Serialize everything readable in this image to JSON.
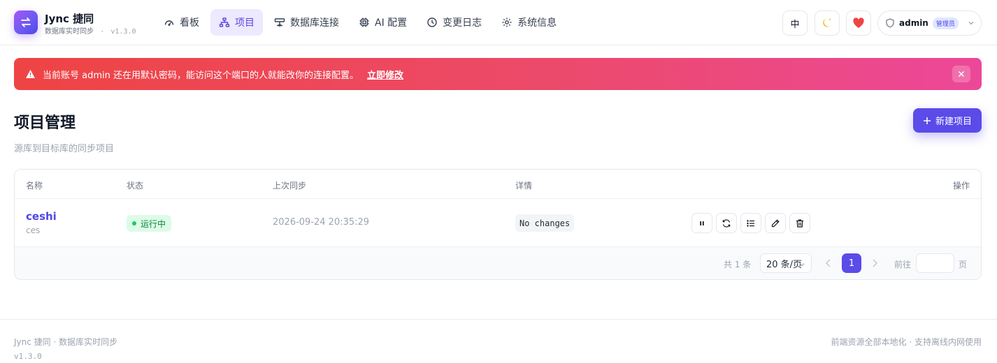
{
  "brand": {
    "name": "Jync 捷同",
    "subtitle": "数据库实时同步",
    "version": "v1.3.0"
  },
  "nav": [
    {
      "label": "看板",
      "icon": "dashboard-icon",
      "active": false
    },
    {
      "label": "项目",
      "icon": "project-tree-icon",
      "active": true
    },
    {
      "label": "数据库连接",
      "icon": "database-connection-icon",
      "active": false
    },
    {
      "label": "AI 配置",
      "icon": "chip-icon",
      "active": false
    },
    {
      "label": "变更日志",
      "icon": "clock-icon",
      "active": false
    },
    {
      "label": "系统信息",
      "icon": "gear-icon",
      "active": false
    }
  ],
  "header": {
    "lang_label": "中",
    "user_name": "admin",
    "user_role": "管理员"
  },
  "banner": {
    "message": "当前账号 admin 还在用默认密码，能访问这个端口的人就能改你的连接配置。",
    "link_label": "立即修改"
  },
  "page": {
    "title": "项目管理",
    "subtitle": "源库到目标库的同步项目",
    "new_button_label": "新建项目"
  },
  "table": {
    "columns": {
      "name": "名称",
      "status": "状态",
      "last_sync": "上次同步",
      "detail": "详情",
      "actions": "操作"
    },
    "rows": [
      {
        "name": "ceshi",
        "desc": "ces",
        "status": "运行中",
        "last_sync": "2026-09-24 20:35:29",
        "detail": "No changes"
      }
    ]
  },
  "pagination": {
    "total_label": "共 1 条",
    "page_size": "20 条/页",
    "current_page": "1",
    "goto_label": "前往",
    "goto_suffix": "页"
  },
  "footer": {
    "left": "Jync 捷同 · 数据库实时同步",
    "version": "v1.3.0",
    "right": "前端资源全部本地化 · 支持离线内网使用"
  },
  "colors": {
    "accent": "#5b4be8",
    "banner_start": "#ef4444",
    "banner_end": "#ec4899",
    "status_green": "#15803d"
  }
}
